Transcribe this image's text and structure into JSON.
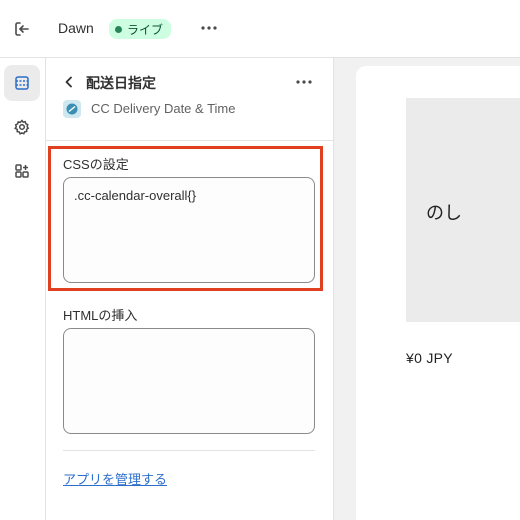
{
  "topbar": {
    "theme_name": "Dawn",
    "live_label": "ライブ",
    "icons": {
      "exit": "exit-icon",
      "more": "more-horizontal-icon"
    },
    "colors": {
      "live_bg": "#cdfee1",
      "live_dot": "#29845a"
    }
  },
  "rail": {
    "items": [
      {
        "name": "sections",
        "icon": "sections-icon",
        "active": true
      },
      {
        "name": "settings",
        "icon": "gear-icon",
        "active": false
      },
      {
        "name": "apps",
        "icon": "apps-icon",
        "active": false
      }
    ]
  },
  "panel": {
    "title": "配送日指定",
    "app_name": "CC Delivery Date & Time",
    "css_field": {
      "label": "CSSの設定",
      "value": ".cc-calendar-overall{}"
    },
    "html_field": {
      "label": "HTMLの挿入",
      "value": ""
    },
    "manage_link": "アプリを管理する",
    "highlight_color": "#e0401f"
  },
  "preview": {
    "product_name": "のし",
    "price": "¥0 JPY"
  }
}
